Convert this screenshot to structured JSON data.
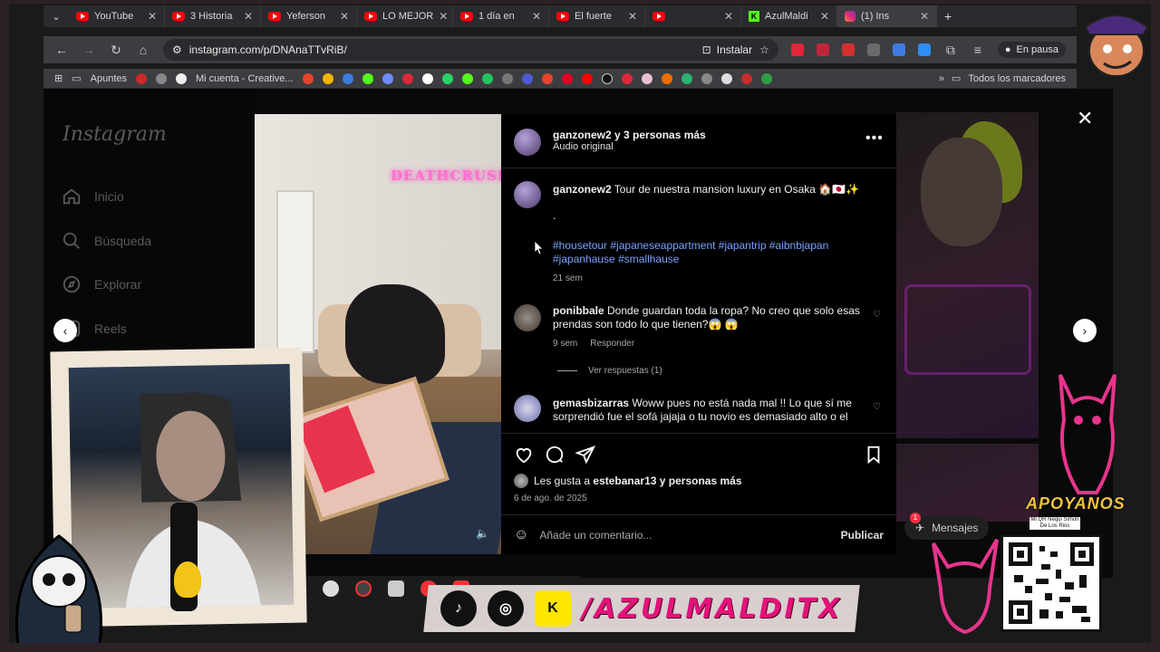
{
  "browser": {
    "tabs": [
      {
        "label": "YouTube",
        "icon": "youtube-icon"
      },
      {
        "label": "3 Historia",
        "icon": "youtube-icon"
      },
      {
        "label": "Yeferson",
        "icon": "youtube-icon"
      },
      {
        "label": "LO MEJOR",
        "icon": "youtube-icon"
      },
      {
        "label": "1 día en",
        "icon": "youtube-icon"
      },
      {
        "label": "El fuerte",
        "icon": "youtube-icon"
      },
      {
        "label": "",
        "icon": "youtube-icon"
      },
      {
        "label": "AzulMaldi",
        "icon": "kick-icon"
      },
      {
        "label": "(1) Ins",
        "icon": "instagram-icon"
      }
    ],
    "url": "instagram.com/p/DNAnaTTvRiB/",
    "install_label": "Instalar",
    "pause_label": "En pausa",
    "bookmarks": [
      "Apuntes",
      "Mi cuenta - Creative..."
    ],
    "bookmarks_right": "Todos los marcadores"
  },
  "instagram": {
    "logo": "Instagram",
    "nav": [
      "Inicio",
      "Búsqueda",
      "Explorar",
      "Reels"
    ],
    "post": {
      "header_user": "ganzonew2",
      "header_suffix": " y 3 personas más",
      "audio": "Audio original",
      "caption_user": "ganzonew2",
      "caption_text": " Tour de nuestra mansion luxury en Osaka 🏠🇯🇵✨",
      "caption_dot": ".",
      "hashtags_line1": "#housetour #japaneseappartment #japantrip #aibnbjapan",
      "hashtags_line2": "#japanhause #smallhause",
      "caption_time": "21 sem",
      "media_text": "DEATHCRUSH",
      "comments": [
        {
          "user": "ponibbale",
          "text": " Donde guardan toda la ropa? No creo que solo esas prendas son todo lo que tienen?😱 😱",
          "time": "9 sem",
          "reply": "Responder"
        },
        {
          "user": "gemasbizarras",
          "text": " Woww pues no está nada mal !! Lo que sí me sorprendió fue el sofá jajaja o tu novio es demasiado alto o el"
        }
      ],
      "view_replies": "Ver respuestas (1)",
      "likes_prefix": "Les gusta a ",
      "likes_user": "estebanar13",
      "likes_suffix": " y personas más",
      "date": "6 de ago. de 2025",
      "comment_placeholder": "Añade un comentario...",
      "publish": "Publicar"
    },
    "messages": "Mensajes",
    "messages_badge": "1"
  },
  "overlay": {
    "handle": "/AZULMALDITX",
    "support": "APOYANOS",
    "qr_label": "Mi QR Nequi Simon De Los Rios"
  }
}
